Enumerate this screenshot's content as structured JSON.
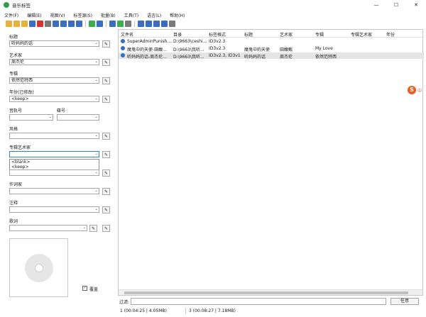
{
  "window": {
    "title": "音乐标签",
    "min": "—",
    "max": "☐",
    "close": "✕"
  },
  "menu": [
    "文件(F)",
    "编辑(E)",
    "视图(V)",
    "标签源(S)",
    "批量(B)",
    "工具(T)",
    "语言(L)",
    "帮助(H)"
  ],
  "toolbar_colors": [
    "#e8b23a",
    "#e8b23a",
    "#e8b23a",
    "#3a6ec4",
    "#d93030",
    "#7a7a7a",
    "#3a6ec4",
    "#3a6ec4",
    "#3a6ec4",
    "#3a6ec4",
    "#3ab04a",
    "#3a6ec4",
    "#3a6ec4",
    "#3ab04a",
    "#7a7a7a",
    "#3a6ec4",
    "#3a6ec4",
    "#3a6ec4",
    "#3a6ec4",
    "#7a7a7a",
    "#7a7a7a"
  ],
  "fields": {
    "title": {
      "label": "标题",
      "value": "听妈妈的话"
    },
    "artist": {
      "label": "艺术家",
      "value": "周杰伦"
    },
    "album": {
      "label": "专辑",
      "value": "依然范特西"
    },
    "year": {
      "label": "年份(已修改)",
      "value": "<keep>"
    },
    "track": {
      "label": "音轨号",
      "value": ""
    },
    "disc": {
      "label": "碟号",
      "value": ""
    },
    "genre": {
      "label": "风格",
      "value": ""
    },
    "album_artist": {
      "label": "专辑艺术家",
      "value": ""
    },
    "composer": {
      "label": "作词家",
      "value": ""
    },
    "comment": {
      "label": "注释",
      "value": ""
    },
    "lyrics": {
      "label": "歌词",
      "value": ""
    }
  },
  "dropdown_options": [
    "<blank>",
    "<keep>"
  ],
  "cover": {
    "overwrite_label": "覆盖",
    "overwrite_checked": "✓"
  },
  "columns": [
    "文件名",
    "目录",
    "标签格式",
    "标题",
    "艺术家",
    "专辑",
    "专辑艺术家",
    "年份"
  ],
  "rows": [
    {
      "file": "SuperAdminPunish....",
      "dir": "D:\\9663\\ceshi...",
      "format": "ID3v2.3",
      "title": "",
      "artist": "",
      "album": "",
      "album_artist": "",
      "year": ""
    },
    {
      "file": "魔鬼中的天使-田馥...",
      "dir": "D:\\9663\\我听...",
      "format": "ID3v2.3",
      "title": "魔鬼中的天使",
      "artist": "田馥甄",
      "album": "My Love",
      "album_artist": "",
      "year": ""
    },
    {
      "file": "听妈妈的话-周杰伦...",
      "dir": "D:\\9663\\我听...",
      "format": "ID3v2.3, ID3v1",
      "title": "听妈妈的话",
      "artist": "周杰伦",
      "album": "依然范特西",
      "album_artist": "",
      "year": ""
    }
  ],
  "filter": {
    "label": "过滤:",
    "button": "任意"
  },
  "status": {
    "selected": "1 (00:04:25 | 4.05MB)",
    "total": "3 (00:08:27 | 7.18MB)"
  },
  "ime": {
    "logo": "S",
    "mode": "中"
  }
}
